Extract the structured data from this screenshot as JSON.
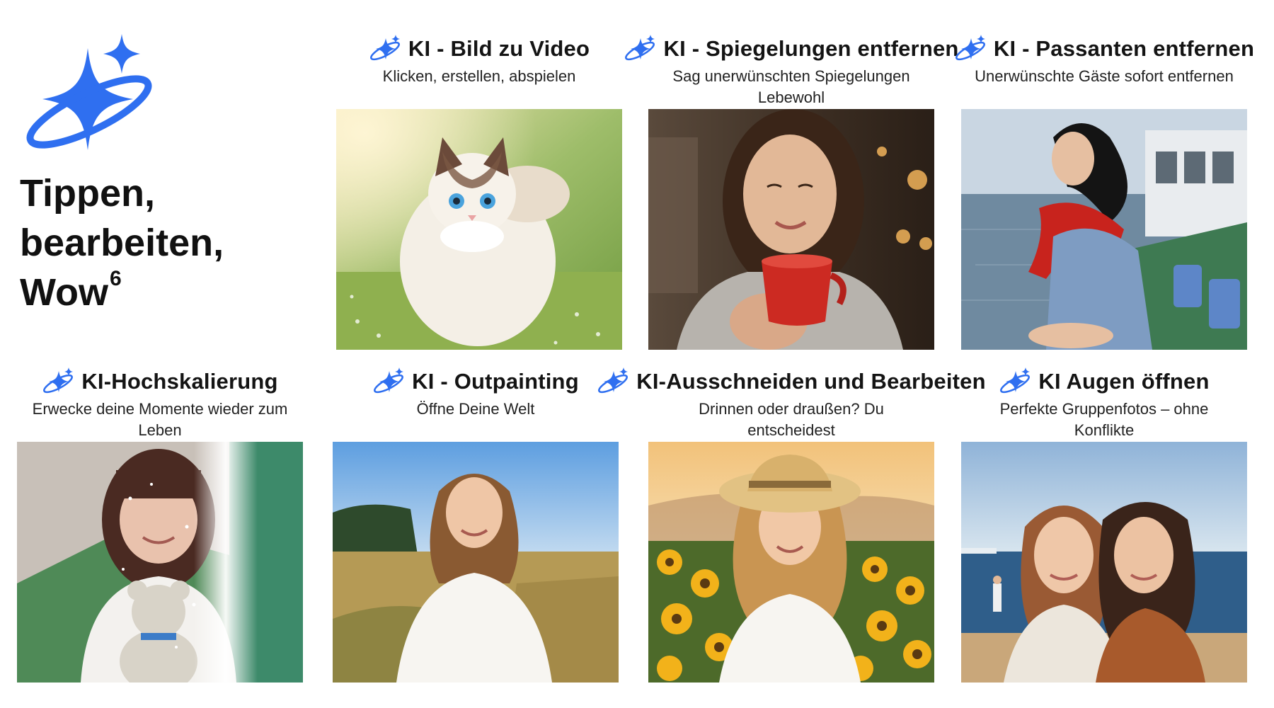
{
  "hero": {
    "logo_icon": "ai-sparkle-orbit-icon",
    "title_line1": "Tippen,",
    "title_line2": "bearbeiten,",
    "title_line3": "Wow",
    "footnote_mark": "6"
  },
  "colors": {
    "accent_blue": "#2f6ff0",
    "text_dark": "#141414"
  },
  "features": [
    {
      "icon": "ai-sparkle-icon",
      "title": "KI - Bild zu Video",
      "subtitle": "Klicken, erstellen, abspielen",
      "image": "cat-in-meadow-photo"
    },
    {
      "icon": "ai-sparkle-icon",
      "title": "KI - Spiegelungen entfernen",
      "subtitle": "Sag unerwünschten Spiegelungen Lebewohl",
      "image": "woman-with-red-cup-photo"
    },
    {
      "icon": "ai-sparkle-icon",
      "title": "KI - Passanten entfernen",
      "subtitle": "Unerwünschte Gäste sofort entfernen",
      "image": "woman-on-ferry-deck-photo"
    },
    {
      "icon": "ai-sparkle-icon",
      "title": "KI-Hochskalierung",
      "subtitle": "Erwecke deine Momente wieder zum Leben",
      "image": "girl-with-teddy-bear-photo"
    },
    {
      "icon": "ai-sparkle-icon",
      "title": "KI - Outpainting",
      "subtitle": "Öffne Deine Welt",
      "image": "woman-in-field-photo"
    },
    {
      "icon": "ai-sparkle-icon",
      "title": "KI-Ausschneiden und Bearbeiten",
      "subtitle": "Drinnen oder draußen? Du entscheidest",
      "image": "girl-in-sunflower-field-photo"
    },
    {
      "icon": "ai-sparkle-icon",
      "title": "KI Augen öffnen",
      "subtitle": "Perfekte Gruppenfotos – ohne Konflikte",
      "image": "two-women-at-beach-photo"
    }
  ]
}
